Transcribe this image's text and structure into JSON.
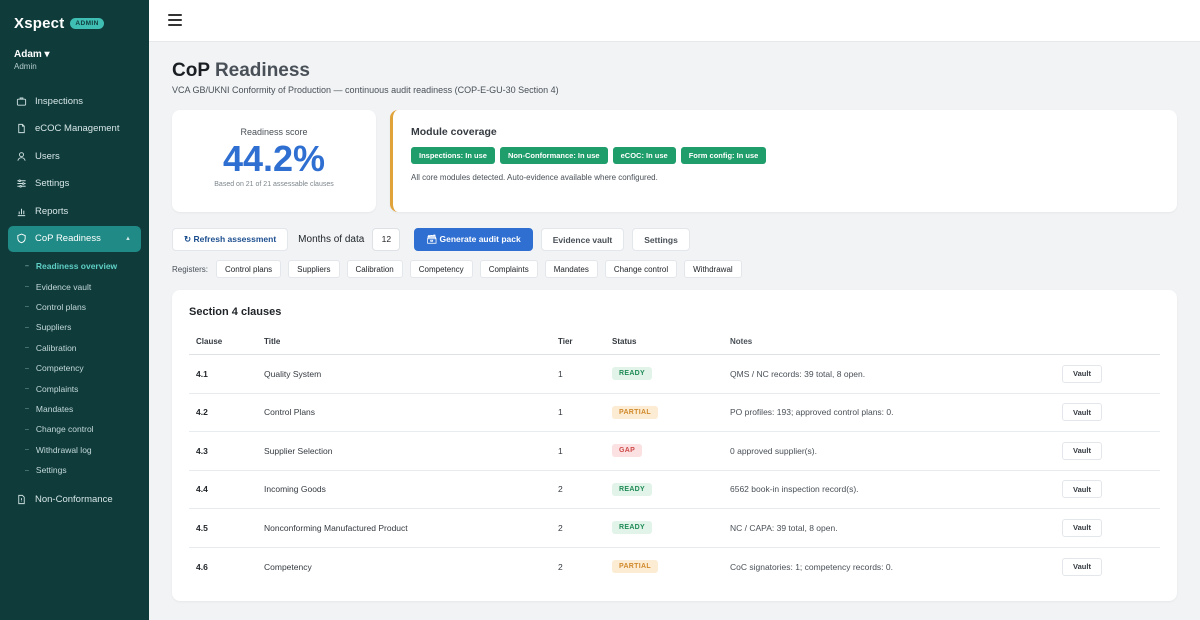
{
  "sidebar": {
    "brand": "Xspect",
    "badge": "ADMIN",
    "user_name": "Adam ▾",
    "user_role": "Admin",
    "items": [
      {
        "label": "Inspections",
        "icon": "briefcase-icon"
      },
      {
        "label": "eCOC Management",
        "icon": "document-icon"
      },
      {
        "label": "Users",
        "icon": "user-icon"
      },
      {
        "label": "Settings",
        "icon": "sliders-icon"
      },
      {
        "label": "Reports",
        "icon": "bar-chart-icon"
      },
      {
        "label": "CoP Readiness",
        "icon": "shield-icon",
        "active": true,
        "caret": "▲"
      }
    ],
    "subitems": [
      "Readiness overview",
      "Evidence vault",
      "Control plans",
      "Suppliers",
      "Calibration",
      "Competency",
      "Complaints",
      "Mandates",
      "Change control",
      "Withdrawal log",
      "Settings"
    ],
    "sub_bullet": "–",
    "after_items": [
      {
        "label": "Non-Conformance",
        "icon": "document-alert-icon"
      }
    ]
  },
  "header": {
    "title_bold": "CoP",
    "title_rest": "Readiness",
    "subtitle": "VCA GB/UKNI Conformity of Production — continuous audit readiness (COP-E-GU-30 Section 4)"
  },
  "score": {
    "label": "Readiness score",
    "value": "44.2%",
    "note": "Based on 21 of 21 assessable clauses",
    "color": "#2f6fd1"
  },
  "coverage": {
    "title": "Module coverage",
    "badges": [
      "Inspections: In use",
      "Non-Conformance: In use",
      "eCOC: In use",
      "Form config: In use"
    ],
    "note": "All core modules detected. Auto-evidence available where configured."
  },
  "toolbar": {
    "refresh_label": "↻ Refresh assessment",
    "months_label": "Months of data",
    "months_value": "12",
    "generate_label": "🗃 Generate audit pack",
    "vault_label": "Evidence vault",
    "settings_label": "Settings"
  },
  "registers": {
    "label": "Registers:",
    "items": [
      "Control plans",
      "Suppliers",
      "Calibration",
      "Competency",
      "Complaints",
      "Mandates",
      "Change control",
      "Withdrawal"
    ]
  },
  "clauses": {
    "title": "Section 4 clauses",
    "headers": {
      "clause": "Clause",
      "title": "Title",
      "tier": "Tier",
      "status": "Status",
      "notes": "Notes"
    },
    "action_label": "Vault",
    "rows": [
      {
        "clause": "4.1",
        "title": "Quality System",
        "tier": "1",
        "status": "READY",
        "status_kind": "ready",
        "notes": "QMS / NC records: 39 total, 8 open."
      },
      {
        "clause": "4.2",
        "title": "Control Plans",
        "tier": "1",
        "status": "PARTIAL",
        "status_kind": "partial",
        "notes": "PO profiles: 193; approved control plans: 0."
      },
      {
        "clause": "4.3",
        "title": "Supplier Selection",
        "tier": "1",
        "status": "GAP",
        "status_kind": "gap",
        "notes": "0 approved supplier(s)."
      },
      {
        "clause": "4.4",
        "title": "Incoming Goods",
        "tier": "2",
        "status": "READY",
        "status_kind": "ready",
        "notes": "6562 book-in inspection record(s)."
      },
      {
        "clause": "4.5",
        "title": "Nonconforming Manufactured Product",
        "tier": "2",
        "status": "READY",
        "status_kind": "ready",
        "notes": "NC / CAPA: 39 total, 8 open."
      },
      {
        "clause": "4.6",
        "title": "Competency",
        "tier": "2",
        "status": "PARTIAL",
        "status_kind": "partial",
        "notes": "CoC signatories: 1; competency records: 0."
      }
    ]
  },
  "colors": {
    "sidebar_bg": "#0f3b3b",
    "accent": "#1f8a86",
    "primary": "#2f6fd1",
    "ready": "#1f8a55",
    "partial": "#d08a2c",
    "gap": "#cf4b4b"
  }
}
